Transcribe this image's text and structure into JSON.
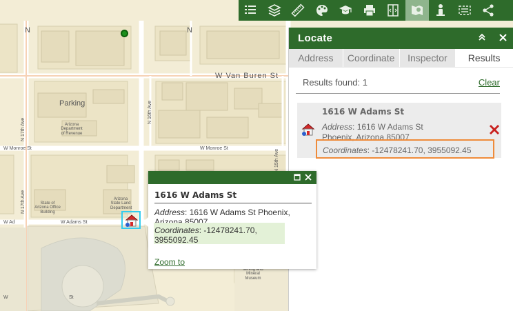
{
  "colors": {
    "toolbar": "#2e6b2b",
    "active_tool": "#8fb58d",
    "highlight": "#ef8b3a",
    "coord_bg": "#e3f1d7"
  },
  "toolbar": {
    "tools": [
      {
        "name": "legend-icon",
        "active": false
      },
      {
        "name": "layers-icon",
        "active": false
      },
      {
        "name": "measure-icon",
        "active": false
      },
      {
        "name": "basemap-gallery-icon",
        "active": false
      },
      {
        "name": "education-icon",
        "active": false
      },
      {
        "name": "print-icon",
        "active": false
      },
      {
        "name": "swipe-icon",
        "active": false
      },
      {
        "name": "locate-icon",
        "active": true
      },
      {
        "name": "person-icon",
        "active": false
      },
      {
        "name": "select-icon",
        "active": false
      },
      {
        "name": "share-icon",
        "active": false
      }
    ]
  },
  "map": {
    "streets": {
      "van_buren": "W Van Buren St",
      "monroe": "W Monroe St",
      "adams": "W Adams St",
      "n_top": "N",
      "n_top2": "N",
      "n_17th_ave": "N 17th Ave",
      "n_17th_ave_2": "N 17th Ave",
      "n_16th_ave": "N 16th Ave",
      "n_15th_ave": "N 15th Ave",
      "w_monroe_left": "W Monroe St",
      "w_adams_left": "W Ad",
      "w_st_bottom": "W",
      "st_bottom": "St"
    },
    "buildings": {
      "parking": "Parking",
      "revenue": "Arizona Department of Revenue",
      "state_office": "State of Arizona Office Building",
      "state_land": "Arizona State Land Department",
      "mineral_museum": "Mining and Mineral Museum"
    }
  },
  "panel": {
    "title": "Locate",
    "collapse_icon": "double-chevron-up-icon",
    "close_icon": "close-icon",
    "tabs": [
      {
        "label": "Address",
        "active": false
      },
      {
        "label": "Coordinate",
        "active": false
      },
      {
        "label": "Inspector",
        "active": false
      },
      {
        "label": "Results",
        "active": true
      }
    ],
    "results_found": "Results found: 1",
    "clear_label": "Clear",
    "result": {
      "title": "1616 W Adams St",
      "address_label": "Address",
      "address_line1": ": 1616 W Adams St",
      "address_line2": "Phoenix, Arizona 85007",
      "coord_label": "Coordinates",
      "coord_value": ": -12478241.70, 3955092.45"
    }
  },
  "popup": {
    "title": "1616 W Adams St",
    "address_label": "Address",
    "address_line1": ": 1616 W Adams St Phoenix,",
    "address_line2": "Arizona 85007",
    "coord_label": "Coordinates",
    "coord_line1": ": -12478241.70,",
    "coord_line2": "3955092.45",
    "zoom_label": "Zoom to",
    "maximize_icon": "maximize-icon",
    "close_icon": "close-icon"
  }
}
